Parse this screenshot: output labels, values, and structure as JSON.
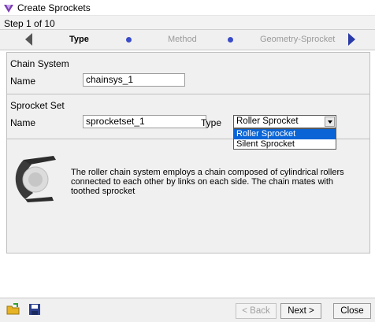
{
  "window": {
    "title": "Create Sprockets"
  },
  "wizard": {
    "step_text": "Step 1 of 10",
    "steps": [
      {
        "label": "Type",
        "active": true
      },
      {
        "label": "Method",
        "active": false
      },
      {
        "label": "Geometry-Sprocket",
        "active": false
      }
    ]
  },
  "chain_system": {
    "section_label": "Chain System",
    "name_label": "Name",
    "name_value": "chainsys_1"
  },
  "sprocket_set": {
    "section_label": "Sprocket Set",
    "name_label": "Name",
    "name_value": "sprocketset_1",
    "type_label": "Type",
    "type_value": "Roller Sprocket",
    "type_options": [
      "Roller Sprocket",
      "Silent Sprocket"
    ]
  },
  "description": "The roller chain system employs a chain composed of cylindrical rollers connected to each other by links on each side. The chain mates with toothed sprocket",
  "footer": {
    "back_label": "< Back",
    "next_label": "Next >",
    "close_label": "Close"
  },
  "colors": {
    "accent": "#3a4cc8",
    "selection": "#0a64d6"
  }
}
